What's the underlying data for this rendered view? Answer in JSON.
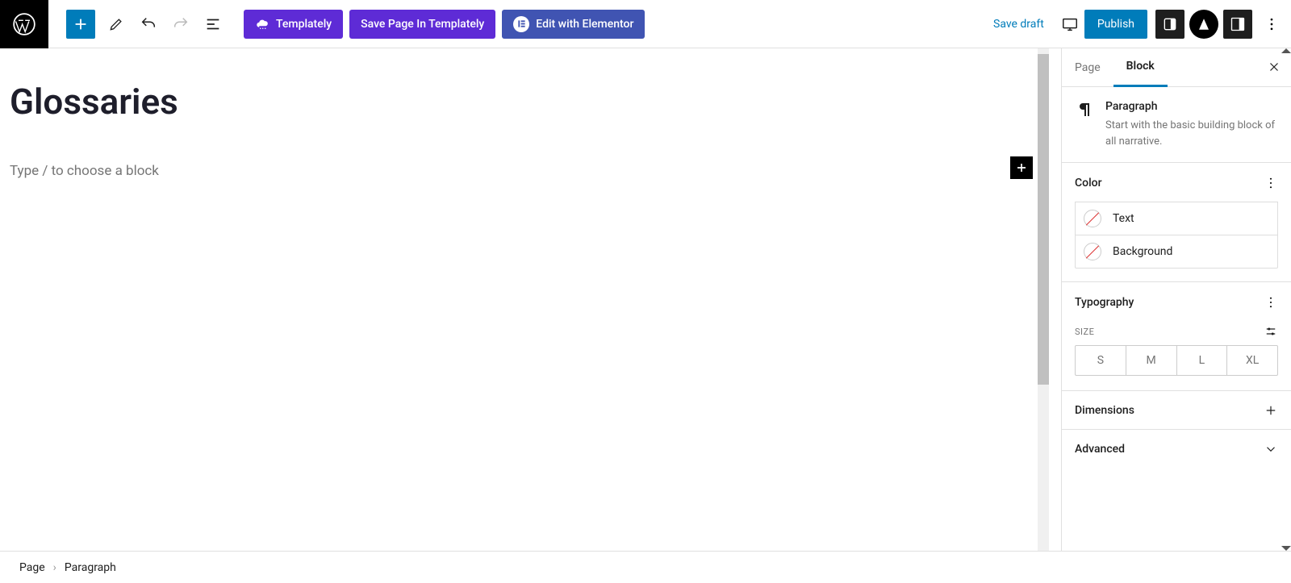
{
  "topbar": {
    "templately_label": "Templately",
    "save_in_templately": "Save Page In Templately",
    "edit_elementor": "Edit with Elementor",
    "save_draft": "Save draft",
    "publish": "Publish"
  },
  "editor": {
    "title": "Glossaries",
    "placeholder": "Type / to choose a block"
  },
  "sidebar": {
    "tabs": {
      "page": "Page",
      "block": "Block"
    },
    "block": {
      "name": "Paragraph",
      "description": "Start with the basic building block of all narrative."
    },
    "color": {
      "title": "Color",
      "text_label": "Text",
      "background_label": "Background"
    },
    "typography": {
      "title": "Typography",
      "size_label": "SIZE",
      "sizes": [
        "S",
        "M",
        "L",
        "XL"
      ]
    },
    "dimensions": "Dimensions",
    "advanced": "Advanced"
  },
  "breadcrumbs": [
    "Page",
    "Paragraph"
  ]
}
